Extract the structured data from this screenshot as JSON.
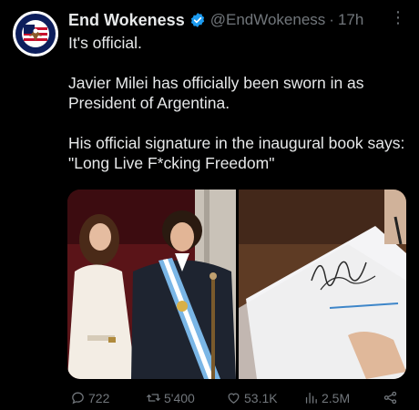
{
  "author": {
    "name": "End Wokeness",
    "handle": "@EndWokeness",
    "separator": "·",
    "time": "17h",
    "avatar_icon": "eagle-flag-logo",
    "avatar_ring_text": "EXPORT THE AMERICA PEOPLE SENSE"
  },
  "tweet": {
    "line1": "It's official.",
    "line2": "Javier Milei has officially been sworn in as President of Argentina.",
    "line3": "His official signature in the inaugural book says: \"Long Live F*cking Freedom\""
  },
  "media": {
    "image1_icon": "inauguration-photo",
    "image2_icon": "signature-photo"
  },
  "actions": {
    "replies": "722",
    "retweets": "5'400",
    "likes": "53.1K",
    "views": "2.5M"
  },
  "colors": {
    "verified": "#1d9bf0",
    "muted": "#71767b",
    "text": "#e7e9ea"
  }
}
